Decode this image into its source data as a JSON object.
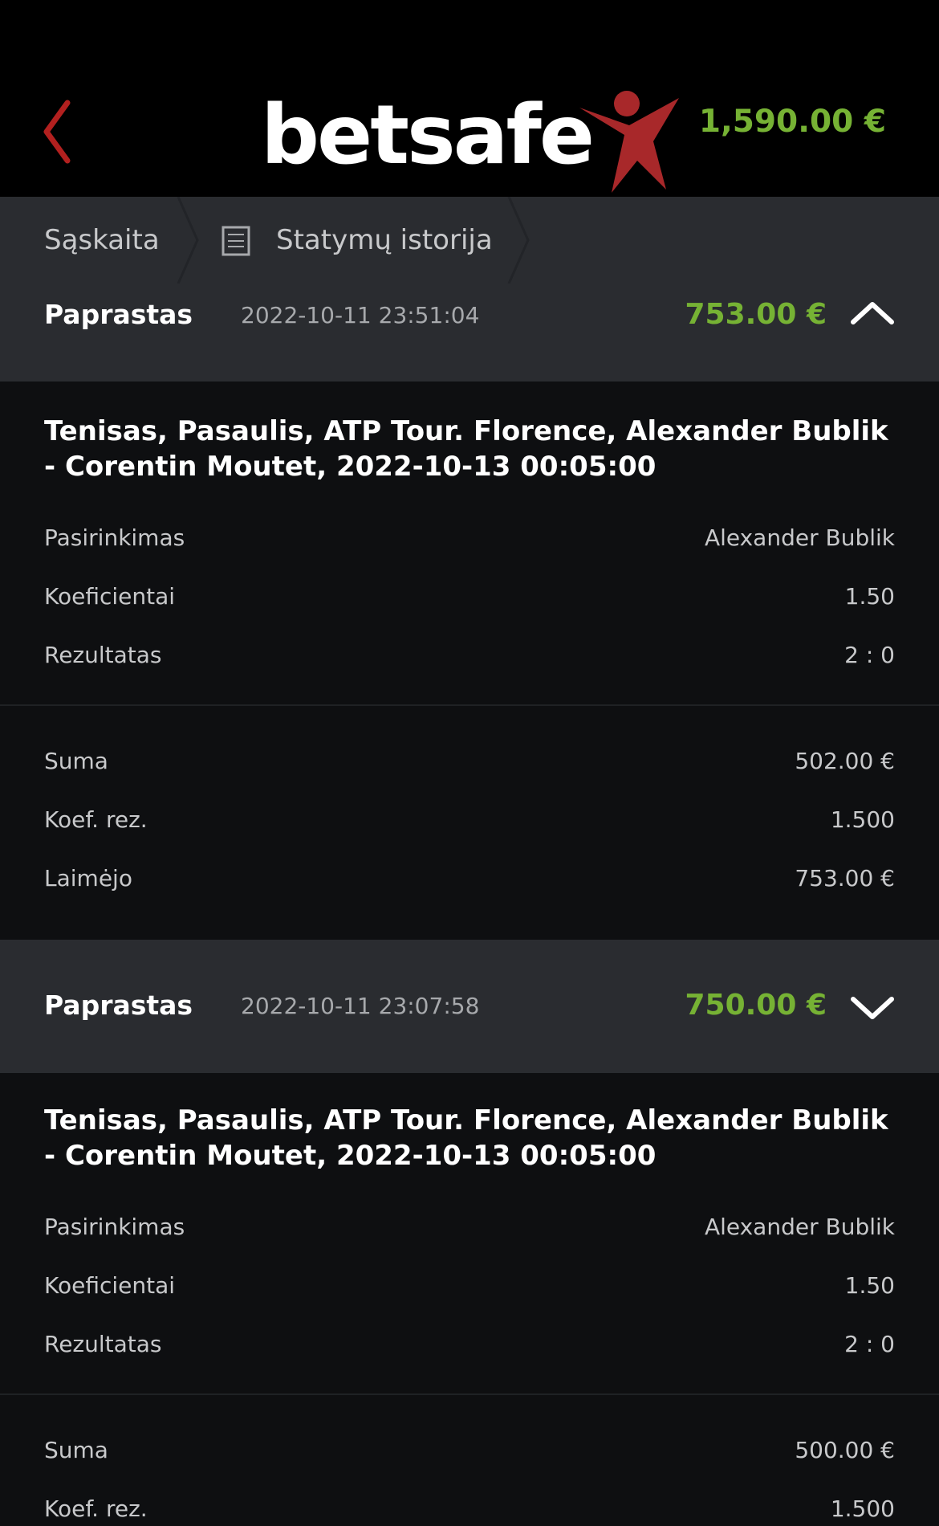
{
  "header": {
    "logo_text": "betsafe",
    "balance": "1,590.00 €",
    "icons": {
      "back": "chevron-left-icon",
      "logo_mark": "star-figure-logo"
    },
    "colors": {
      "accent_green": "#76b234",
      "brand_red": "#a8282a",
      "back_red": "#b2201f"
    }
  },
  "breadcrumb": {
    "items": [
      {
        "label": "Sąskaita"
      },
      {
        "label": "Statymų istorija",
        "icon": "list-document-icon"
      }
    ]
  },
  "bets": [
    {
      "type": "Paprastas",
      "date": "2022-10-11 23:51:04",
      "amount": "753.00 €",
      "expanded_icon": "chevron-up-icon",
      "event": "Tenisas, Pasaulis, ATP Tour. Florence, Alexander Bublik - Corentin Moutet, 2022-10-13 00:05:00",
      "details": [
        {
          "label": "Pasirinkimas",
          "value": "Alexander Bublik"
        },
        {
          "label": "Koeficientai",
          "value": "1.50"
        },
        {
          "label": "Rezultatas",
          "value": "2 : 0"
        }
      ],
      "summary": [
        {
          "label": "Suma",
          "value": "502.00 €"
        },
        {
          "label": "Koef. rez.",
          "value": "1.500"
        },
        {
          "label": "Laimėjo",
          "value": "753.00 €"
        }
      ]
    },
    {
      "type": "Paprastas",
      "date": "2022-10-11 23:07:58",
      "amount": "750.00 €",
      "expanded_icon": "chevron-down-icon",
      "event": "Tenisas, Pasaulis, ATP Tour. Florence, Alexander Bublik - Corentin Moutet, 2022-10-13 00:05:00",
      "details": [
        {
          "label": "Pasirinkimas",
          "value": "Alexander Bublik"
        },
        {
          "label": "Koeficientai",
          "value": "1.50"
        },
        {
          "label": "Rezultatas",
          "value": "2 : 0"
        }
      ],
      "summary": [
        {
          "label": "Suma",
          "value": "500.00 €"
        },
        {
          "label": "Koef. rez.",
          "value": "1.500"
        }
      ]
    }
  ]
}
